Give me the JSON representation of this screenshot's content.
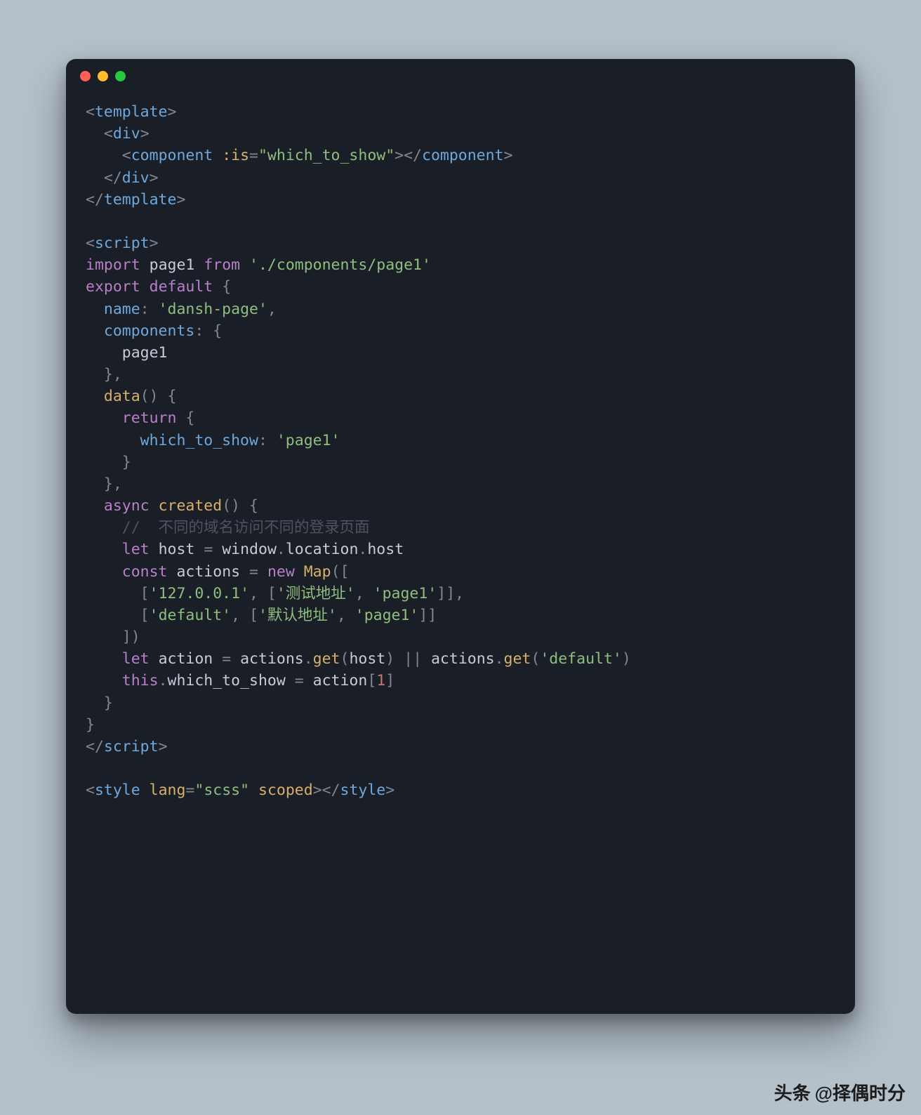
{
  "code": {
    "template_open": "template",
    "div_open": "div",
    "component_tag": "component",
    "component_attr": ":is",
    "component_val": "\"which_to_show\"",
    "component_close": "component",
    "div_close": "div",
    "template_close": "template",
    "script_open": "script",
    "import_kw": "import",
    "import_name": "page1",
    "from_kw": "from",
    "import_path": "'./components/page1'",
    "export_kw": "export",
    "default_kw": "default",
    "name_key": "name",
    "name_val": "'dansh-page'",
    "components_key": "components",
    "page1_ref": "page1",
    "data_fn": "data",
    "return_kw": "return",
    "which_key": "which_to_show",
    "which_val": "'page1'",
    "async_kw": "async",
    "created_fn": "created",
    "comment": "//  不同的域名访问不同的登录页面",
    "let_kw": "let",
    "host_var": "host",
    "window_obj": "window",
    "location_prop": "location",
    "host_prop": "host",
    "const_kw": "const",
    "actions_var": "actions",
    "new_kw": "new",
    "map_cls": "Map",
    "ip_str": "'127.0.0.1'",
    "test_addr": "'测试地址'",
    "page1_str": "'page1'",
    "default_str": "'default'",
    "default_addr": "'默认地址'",
    "action_var": "action",
    "get_fn": "get",
    "or_op": "||",
    "this_kw": "this",
    "which_prop": "which_to_show",
    "idx1": "1",
    "script_close": "script",
    "style_open": "style",
    "lang_attr": "lang",
    "lang_val": "\"scss\"",
    "scoped_attr": "scoped",
    "style_close": "style"
  },
  "watermark": {
    "prefix": "头条",
    "handle": "@择偶时分"
  }
}
